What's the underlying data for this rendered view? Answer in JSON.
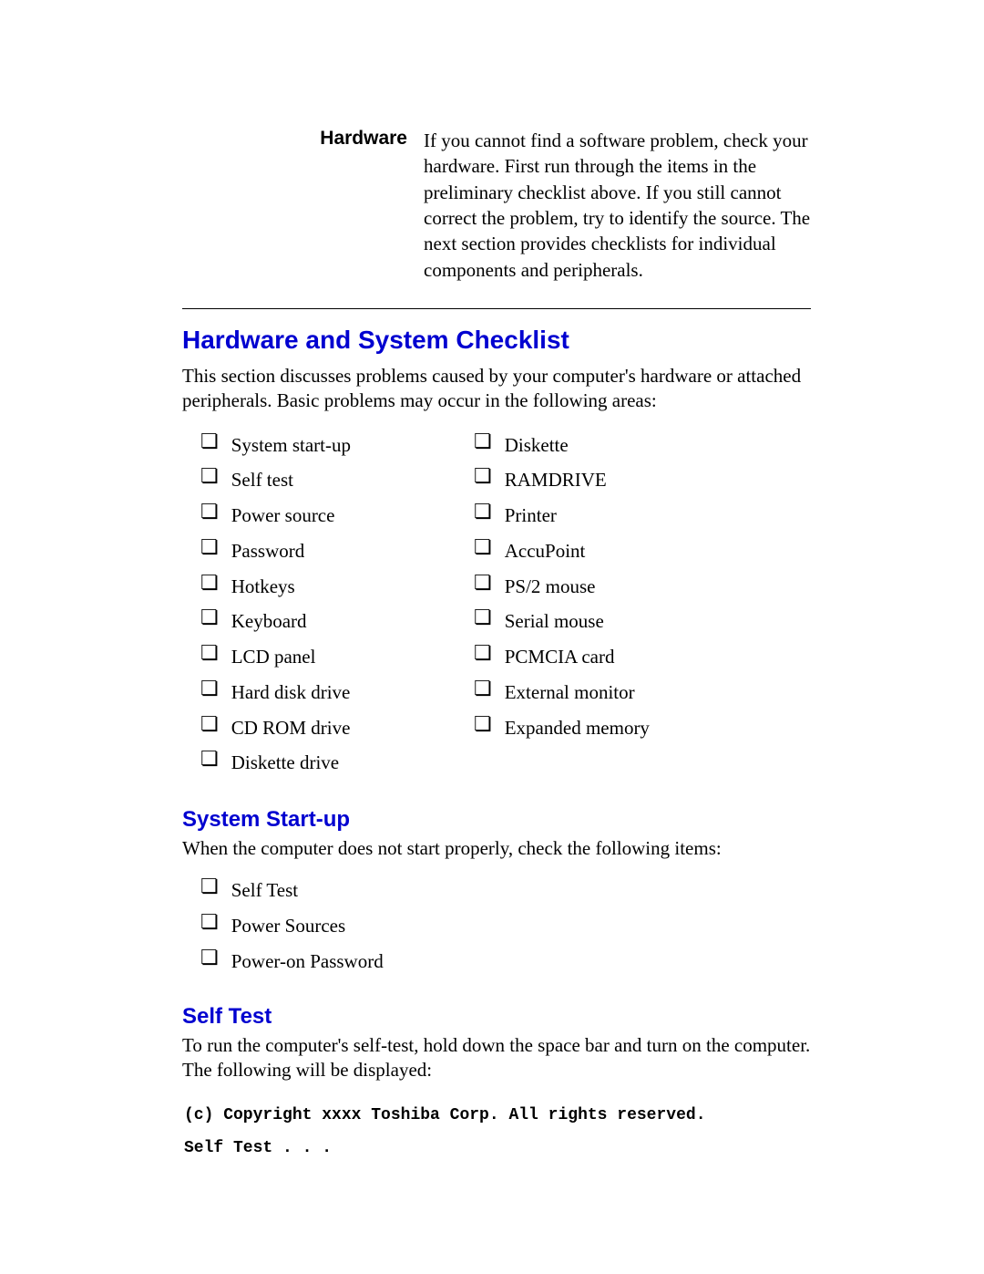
{
  "hardware_block": {
    "label": "Hardware",
    "text": "If you cannot find a software problem, check your hardware. First run through the items in the preliminary checklist above. If you still cannot correct the problem, try to identify the source. The next section provides checklists for individual components and peripherals."
  },
  "section_title": "Hardware and System Checklist",
  "section_intro": "This section discusses problems caused by your computer's hardware or attached peripherals. Basic problems may occur in the following areas:",
  "checklist_left": [
    "System start-up",
    "Self test",
    "Power source",
    "Password",
    "Hotkeys",
    "Keyboard",
    "LCD panel",
    "Hard disk drive",
    "CD ROM drive",
    "Diskette drive"
  ],
  "checklist_right": [
    "Diskette",
    "RAMDRIVE",
    "Printer",
    "AccuPoint",
    "PS/2 mouse",
    "Serial mouse",
    "PCMCIA card",
    "External monitor",
    "Expanded memory"
  ],
  "startup": {
    "title": "System Start-up",
    "intro": "When the computer does not start properly, check the following items:",
    "items": [
      "Self Test",
      "Power Sources",
      "Power-on Password"
    ]
  },
  "selftest": {
    "title": "Self Test",
    "intro": "To run the computer's self-test, hold down the space bar and turn on the computer. The following will be displayed:",
    "display": "(c) Copyright xxxx Toshiba Corp. All rights reserved.\nSelf Test . . ."
  },
  "checkbox_glyph": "❏"
}
